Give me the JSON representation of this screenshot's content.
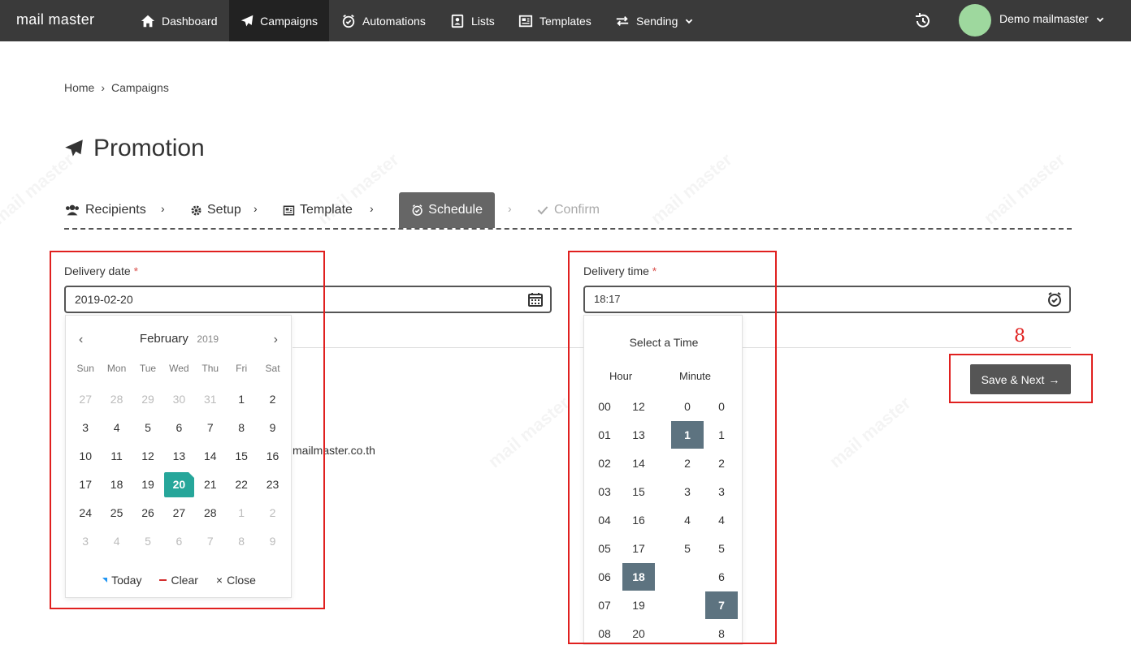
{
  "app": {
    "logo": "mail master"
  },
  "nav": {
    "items": [
      {
        "label": "Dashboard",
        "icon": "home-icon"
      },
      {
        "label": "Campaigns",
        "icon": "paper-plane-icon",
        "active": true
      },
      {
        "label": "Automations",
        "icon": "alarm-clock-icon"
      },
      {
        "label": "Lists",
        "icon": "address-book-icon"
      },
      {
        "label": "Templates",
        "icon": "newspaper-icon"
      },
      {
        "label": "Sending",
        "icon": "exchange-icon",
        "dropdown": true
      }
    ],
    "user": {
      "name": "Demo mailmaster",
      "avatar_color": "#9ed89e"
    }
  },
  "breadcrumb": {
    "home": "Home",
    "separator": "›",
    "current": "Campaigns"
  },
  "page": {
    "title": "Promotion"
  },
  "steps": [
    {
      "label": "Recipients",
      "icon": "users-icon"
    },
    {
      "label": "Setup",
      "icon": "gear-icon"
    },
    {
      "label": "Template",
      "icon": "newspaper-icon"
    },
    {
      "label": "Schedule",
      "icon": "alarm-clock-icon",
      "active": true
    },
    {
      "label": "Confirm",
      "icon": "check-icon",
      "disabled": true
    }
  ],
  "delivery_date": {
    "label": "Delivery date",
    "required_mark": "*",
    "value": "2019-02-20"
  },
  "delivery_time": {
    "label": "Delivery time",
    "required_mark": "*",
    "value": "18:17"
  },
  "email_partial": "mailmaster.co.th",
  "calendar": {
    "prev": "‹",
    "next": "›",
    "month": "February",
    "year": "2019",
    "weekdays": [
      "Sun",
      "Mon",
      "Tue",
      "Wed",
      "Thu",
      "Fri",
      "Sat"
    ],
    "weeks": [
      [
        "27",
        "28",
        "29",
        "30",
        "31",
        "1",
        "2"
      ],
      [
        "3",
        "4",
        "5",
        "6",
        "7",
        "8",
        "9"
      ],
      [
        "10",
        "11",
        "12",
        "13",
        "14",
        "15",
        "16"
      ],
      [
        "17",
        "18",
        "19",
        "20",
        "21",
        "22",
        "23"
      ],
      [
        "24",
        "25",
        "26",
        "27",
        "28",
        "1",
        "2"
      ],
      [
        "3",
        "4",
        "5",
        "6",
        "7",
        "8",
        "9"
      ]
    ],
    "selected": "20",
    "footer": {
      "today": "Today",
      "clear": "Clear",
      "close": "Close",
      "close_mark": "×"
    }
  },
  "timepicker": {
    "title": "Select a Time",
    "hour_label": "Hour",
    "minute_label": "Minute",
    "hours_col1": [
      "00",
      "01",
      "02",
      "03",
      "04",
      "05",
      "06",
      "07",
      "08"
    ],
    "hours_col2": [
      "12",
      "13",
      "14",
      "15",
      "16",
      "17",
      "18",
      "19",
      "20"
    ],
    "minutes_tens": [
      "0",
      "1",
      "2",
      "3",
      "4",
      "5"
    ],
    "minutes_ones": [
      "0",
      "1",
      "2",
      "3",
      "4",
      "5",
      "6",
      "7",
      "8"
    ],
    "selected_hour": "18",
    "selected_minute_tens": "1",
    "selected_minute_ones": "7"
  },
  "annotation": {
    "number": "8",
    "color": "#e0201f"
  },
  "actions": {
    "save_next": "Save & Next",
    "save_next_arrow": "→"
  },
  "watermark": "mail master",
  "colors": {
    "topbar": "#3a3a3a",
    "selected_day": "#26a69a",
    "selected_time": "#5d7380",
    "highlight": "#e0201f"
  }
}
